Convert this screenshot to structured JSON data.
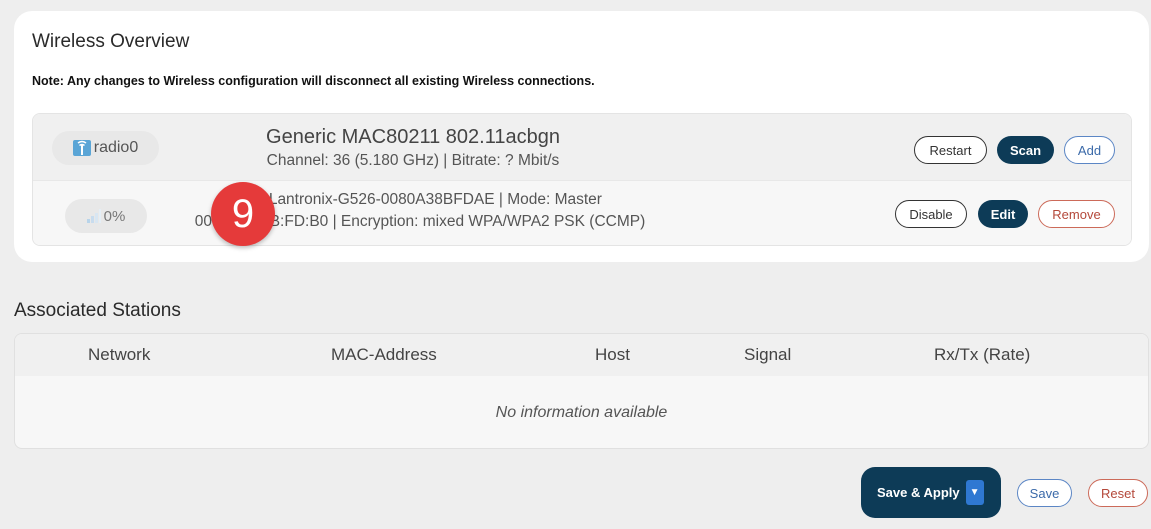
{
  "overview": {
    "title": "Wireless Overview",
    "note": "Note: Any changes to Wireless configuration will disconnect all existing Wireless connections.",
    "radio": {
      "name": "radio0",
      "icon": "wifi-radio-icon",
      "title": "Generic MAC80211 802.11acbgn",
      "subtitle": "Channel: 36 (5.180 GHz) | Bitrate: ? Mbit/s",
      "buttons": {
        "restart": "Restart",
        "scan": "Scan",
        "add": "Add"
      }
    },
    "network": {
      "signal": "0%",
      "icon": "signal-bars-icon",
      "ssid_line": "SSID: Lantronix-G526-0080A38BFDAE | Mode: Master",
      "bssid_line": "00:80:A3:8B:FD:B0 | Encryption: mixed WPA/WPA2 PSK (CCMP)",
      "buttons": {
        "disable": "Disable",
        "edit": "Edit",
        "remove": "Remove"
      }
    }
  },
  "callout": "9",
  "stations": {
    "title": "Associated Stations",
    "columns": [
      "Network",
      "MAC-Address",
      "Host",
      "Signal",
      "Rx/Tx (Rate)"
    ],
    "empty": "No information available"
  },
  "footer": {
    "save_apply": "Save & Apply",
    "save": "Save",
    "reset": "Reset"
  },
  "colors": {
    "primary": "#0d3b57",
    "accent_blue": "#5b86c5",
    "danger": "#cc6a59",
    "callout": "#e53a3a"
  }
}
